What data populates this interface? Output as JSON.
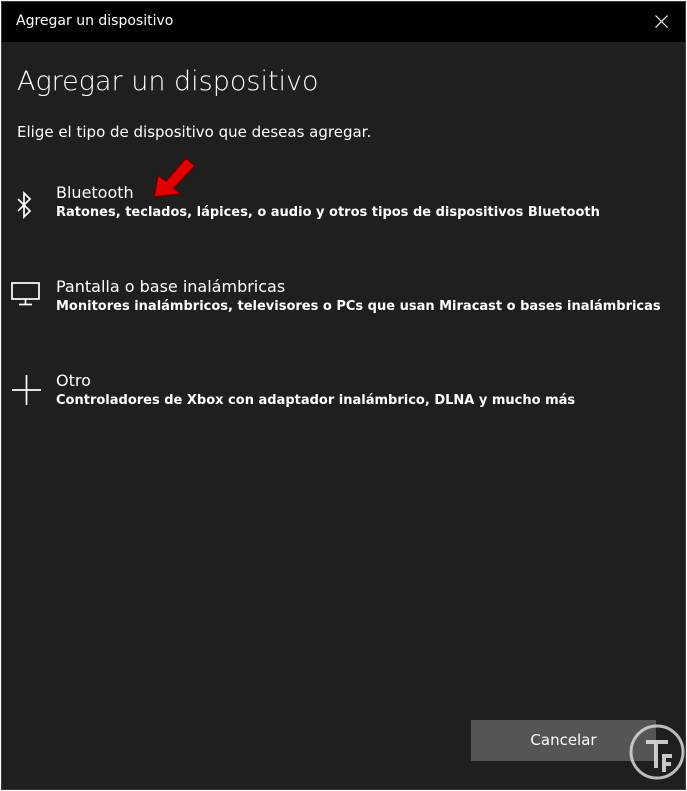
{
  "window": {
    "title": "Agregar un dispositivo"
  },
  "header": {
    "title": "Agregar un dispositivo",
    "subtitle": "Elige el tipo de dispositivo que deseas agregar."
  },
  "options": [
    {
      "icon": "bluetooth-icon",
      "title": "Bluetooth",
      "description": "Ratones, teclados, lápices, o audio y otros tipos de dispositivos Bluetooth"
    },
    {
      "icon": "monitor-icon",
      "title": "Pantalla o base inalámbricas",
      "description": "Monitores inalámbricos, televisores o PCs que usan Miracast o bases inalámbricas"
    },
    {
      "icon": "plus-icon",
      "title": "Otro",
      "description": "Controladores de Xbox con adaptador inalámbrico, DLNA y mucho más"
    }
  ],
  "footer": {
    "cancel_label": "Cancelar"
  },
  "colors": {
    "background": "#1f1f1f",
    "titlebar": "#000000",
    "button": "#555555",
    "annotation_arrow": "#e00000"
  }
}
